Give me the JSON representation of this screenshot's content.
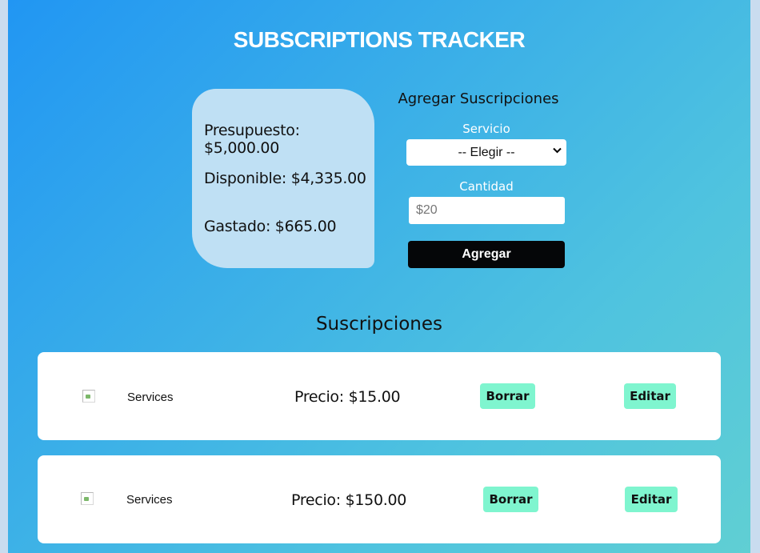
{
  "header": {
    "title": "SUBSCRIPTIONS TRACKER"
  },
  "budget": {
    "presupuesto_label": "Presupuesto:",
    "presupuesto_value": "$5,000.00",
    "disponible_label": "Disponible:",
    "disponible_value": "$4,335.00",
    "gastado_label": "Gastado:",
    "gastado_value": "$665.00"
  },
  "form": {
    "title": "Agregar Suscripciones",
    "service_label": "Servicio",
    "service_selected": "-- Elegir --",
    "amount_label": "Cantidad",
    "amount_placeholder": "$20",
    "amount_value": "",
    "submit_label": "Agregar"
  },
  "subscriptions": {
    "title": "Suscripciones",
    "items": [
      {
        "service": "Services",
        "price_label": "Precio:",
        "price_value": "$15.00",
        "delete_label": "Borrar",
        "edit_label": "Editar"
      },
      {
        "service": "Services",
        "price_label": "Precio:",
        "price_value": "$150.00",
        "delete_label": "Borrar",
        "edit_label": "Editar"
      }
    ]
  },
  "colors": {
    "gradient_start": "#2196f3",
    "gradient_end": "#60cfd3",
    "card_bg": "#bfe0f4",
    "primary_button": "#050608",
    "mint_button": "#7ff5cf"
  },
  "icons": {
    "select_arrow": "chevron-down-icon",
    "service_image": "broken-image-icon"
  }
}
